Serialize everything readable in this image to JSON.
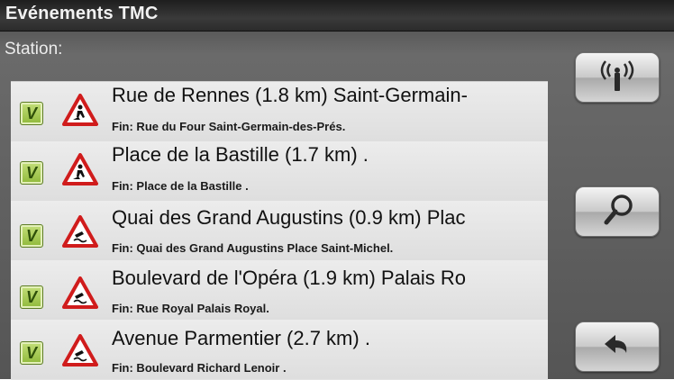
{
  "header": {
    "title": "Evénements TMC"
  },
  "station_label": "Station:",
  "events": [
    {
      "title": "Rue de Rennes (1.8 km) Saint-Germain-",
      "subtitle": "Fin: Rue du Four Saint-Germain-des-Prés.",
      "checked": "V",
      "icon": "roadwork-warning-icon"
    },
    {
      "title": "Place de la Bastille (1.7 km) .",
      "subtitle": "Fin: Place de la Bastille .",
      "checked": "V",
      "icon": "roadwork-warning-icon"
    },
    {
      "title": "Quai des Grand Augustins (0.9 km) Plac",
      "subtitle": "Fin: Quai des Grand Augustins Place Saint-Michel.",
      "checked": "V",
      "icon": "slippery-road-warning-icon"
    },
    {
      "title": "Boulevard de l'Opéra (1.9 km) Palais Ro",
      "subtitle": "Fin: Rue Royal Palais Royal.",
      "checked": "V",
      "icon": "slippery-road-warning-icon"
    },
    {
      "title": "Avenue Parmentier (2.7 km) .",
      "subtitle": "Fin: Boulevard Richard Lenoir .",
      "checked": "V",
      "icon": "slippery-road-warning-icon"
    }
  ],
  "side_buttons": [
    "broadcast-signal-icon",
    "magnifier-icon",
    "back-arrow-icon"
  ],
  "colors": {
    "title_bar": "#2b2b2b",
    "list_bg": "#e3e3e3",
    "check_green": "#8fb93a",
    "warning_red": "#d01c1c"
  }
}
